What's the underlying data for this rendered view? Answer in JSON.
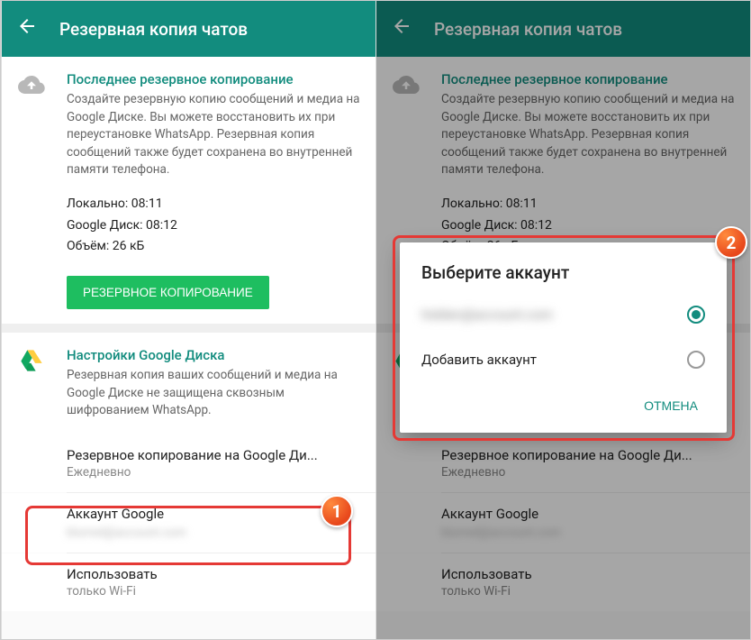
{
  "appBar": {
    "title": "Резервная копия чатов"
  },
  "backup": {
    "sectionTitle": "Последнее резервное копирование",
    "description": "Создайте резервную копию сообщений и медиа на Google Диске. Вы можете восстановить их при переустановке WhatsApp. Резервная копия сообщений также будет сохранена во внутренней памяти телефона.",
    "localLine": "Локально: 08:11",
    "driveLine": "Google Диск: 08:12",
    "sizeLine": "Объём: 26 кБ",
    "buttonLabel": "РЕЗЕРВНОЕ КОПИРОВАНИЕ"
  },
  "driveSettings": {
    "sectionTitle": "Настройки Google Диска",
    "description": "Резервная копия ваших сообщений и медиа на Google Диске не защищена сквозным шифрованием WhatsApp.",
    "freqLabel": "Резервное копирование на Google Ди...",
    "freqValue": "Ежедневно",
    "accountLabel": "Аккаунт Google",
    "accountValue": "blurred@account.com",
    "networkLabel": "Использовать",
    "networkValue": "только Wi-Fi"
  },
  "dialog": {
    "title": "Выберите аккаунт",
    "option1": "hidden@account.com",
    "option2": "Добавить аккаунт",
    "cancelLabel": "ОТМЕНА"
  },
  "badges": {
    "one": "1",
    "two": "2"
  }
}
